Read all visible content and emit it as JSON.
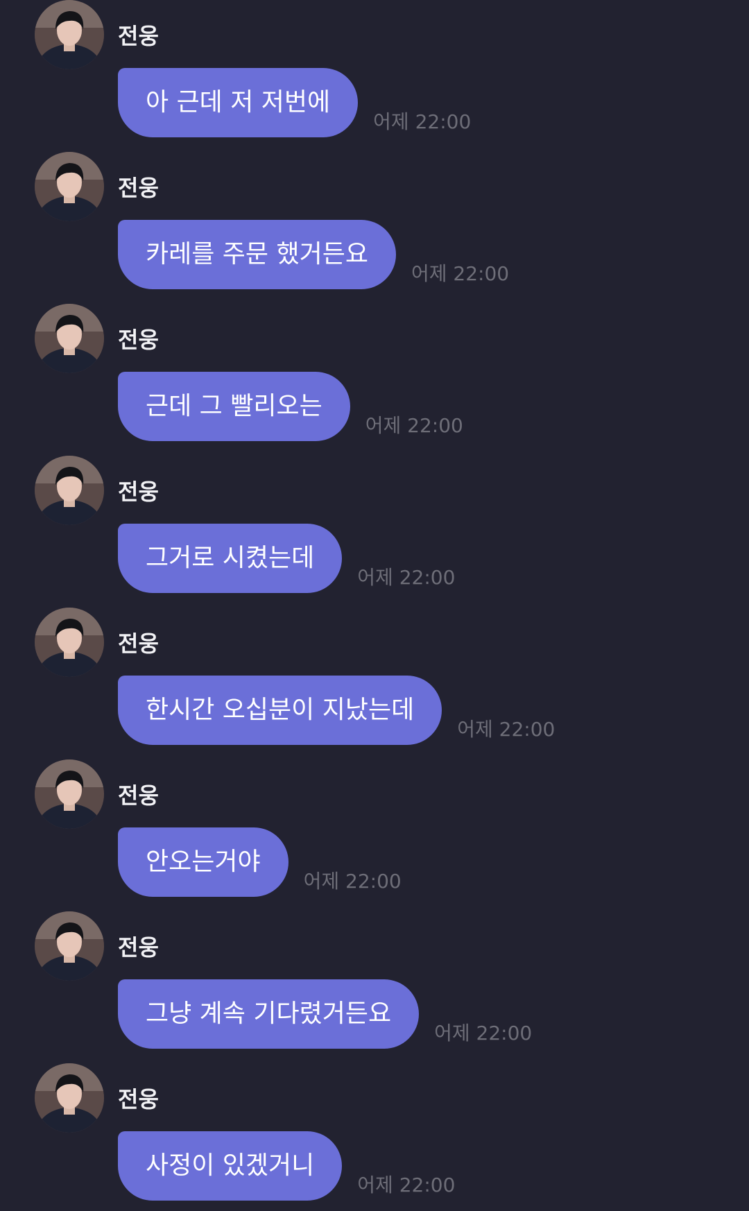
{
  "conversation": {
    "messages": [
      {
        "sender": "전웅",
        "text": "아 근데 저 저번에",
        "time": "어제 22:00"
      },
      {
        "sender": "전웅",
        "text": "카레를 주문 했거든요",
        "time": "어제 22:00"
      },
      {
        "sender": "전웅",
        "text": "근데 그 빨리오는",
        "time": "어제 22:00"
      },
      {
        "sender": "전웅",
        "text": "그거로 시켰는데",
        "time": "어제 22:00"
      },
      {
        "sender": "전웅",
        "text": "한시간 오십분이 지났는데",
        "time": "어제 22:00"
      },
      {
        "sender": "전웅",
        "text": "안오는거야",
        "time": "어제 22:00"
      },
      {
        "sender": "전웅",
        "text": "그냥 계속 기다렸거든요",
        "time": "어제 22:00"
      },
      {
        "sender": "전웅",
        "text": "사정이 있겠거니",
        "time": "어제 22:00"
      }
    ]
  },
  "colors": {
    "background": "#222230",
    "bubble": "#6b6fd8",
    "bubble_text": "#ffffff",
    "sender_text": "#f2f2f5",
    "timestamp_text": "#6e6e78"
  },
  "icons": {
    "avatar": "profile-photo"
  }
}
